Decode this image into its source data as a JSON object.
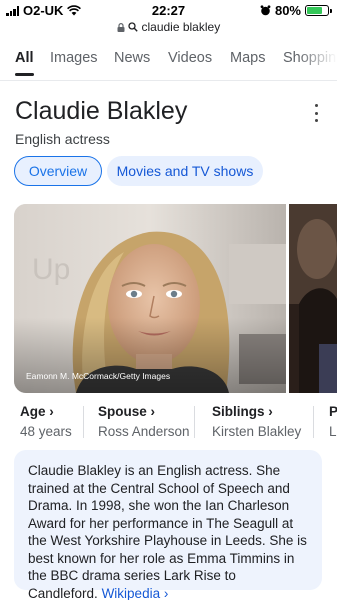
{
  "status_bar": {
    "carrier": "O2-UK",
    "time": "22:27",
    "battery": "80%",
    "battery_level": 0.8
  },
  "address_bar": {
    "url_text": "claudie blakley"
  },
  "tabs": [
    {
      "label": "All",
      "active": true
    },
    {
      "label": "Images",
      "active": false
    },
    {
      "label": "News",
      "active": false
    },
    {
      "label": "Videos",
      "active": false
    },
    {
      "label": "Maps",
      "active": false
    },
    {
      "label": "Shopping",
      "active": false
    }
  ],
  "knowledge_panel": {
    "title": "Claudie Blakley",
    "subtitle": "English actress",
    "chips": [
      "Overview",
      "Movies and TV shows"
    ],
    "photo_credit": "Eamonn M. McCormack/Getty Images",
    "facts": [
      {
        "label": "Age",
        "value": "48 years"
      },
      {
        "label": "Spouse",
        "value": "Ross Anderson"
      },
      {
        "label": "Siblings",
        "value": "Kirsten Blakley"
      },
      {
        "label": "P",
        "value": "L"
      }
    ],
    "description": "Claudie Blakley is an English actress. She trained at the Central School of Speech and Drama. In 1998, she won the Ian Charleson Award for her performance in The Seagull at the West Yorkshire Playhouse in Leeds. She is best known for her role as Emma Timmins in the BBC drama series Lark Rise to Candleford.",
    "source_link": "Wikipedia"
  },
  "colors": {
    "accent": "#1a73e8",
    "chip_bg": "#e8f0fe",
    "description_bg": "#eef3fd",
    "battery_green": "#34c759"
  }
}
